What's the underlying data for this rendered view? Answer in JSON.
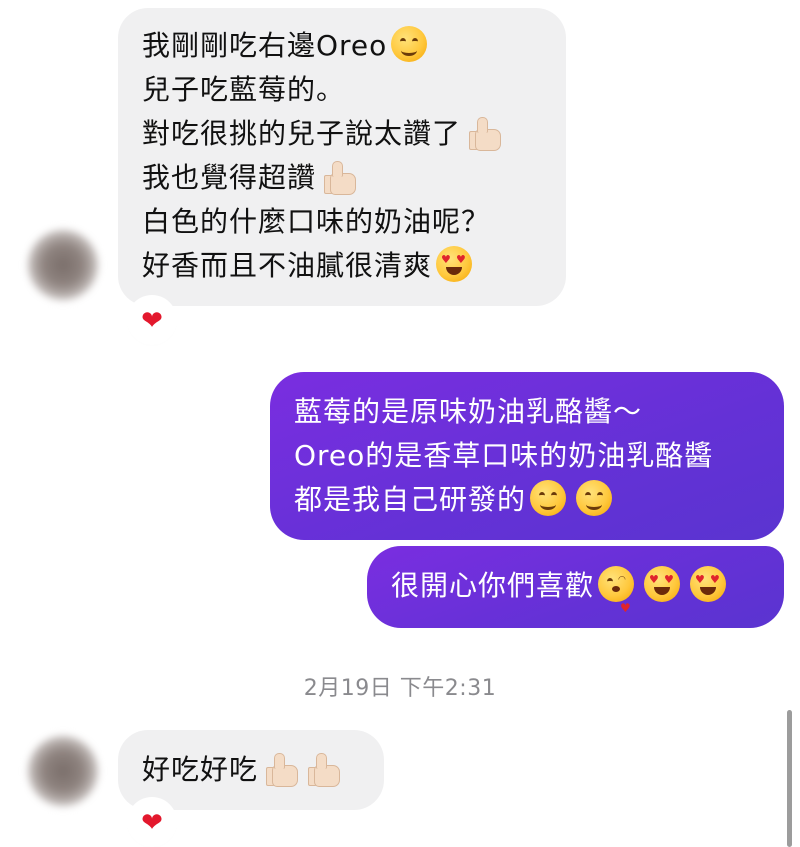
{
  "messages": {
    "m1": {
      "lines": [
        "我剛剛吃右邊Oreo",
        "兒子吃藍莓的。",
        "對吃很挑的兒子說太讚了",
        "我也覺得超讚",
        "白色的什麼口味的奶油呢？",
        "好香而且不油膩很清爽"
      ],
      "reaction": "heart"
    },
    "m2": {
      "lines": [
        "藍莓的是原味奶油乳酪醬～",
        "Oreo的是香草口味的奶油乳酪醬",
        "都是我自己研發的"
      ]
    },
    "m3": {
      "lines": [
        "很開心你們喜歡"
      ]
    },
    "timestamp": "2月19日 下午2:31",
    "m4": {
      "lines": [
        "好吃好吃"
      ],
      "reaction": "heart"
    }
  },
  "icons": {
    "smile": "smiling-face-icon",
    "thumbs": "thumbs-up-icon",
    "heart_eyes": "heart-eyes-face-icon",
    "kiss": "kissing-heart-face-icon",
    "heart": "red-heart-icon"
  },
  "colors": {
    "incoming_bubble": "#f0f0f1",
    "outgoing_bubble": "#6a30d8",
    "heart": "#e3182d",
    "timestamp": "#8a8a8e"
  }
}
